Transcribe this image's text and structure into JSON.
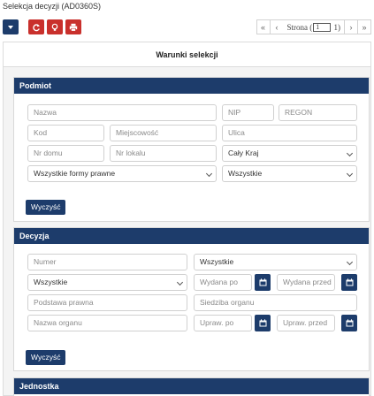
{
  "page": {
    "title": "Selekcja decyzji (AD0360S)"
  },
  "toolbar": {
    "dropdown_icon": "caret-down-icon",
    "refresh_icon": "refresh-icon",
    "lightbulb_icon": "lightbulb-icon",
    "print_icon": "print-icon",
    "accent_blue": "#1d3c6b",
    "accent_red": "#c9302c"
  },
  "pager": {
    "first": "«",
    "prev": "‹",
    "label": "Strona",
    "current_page": "1",
    "total": "1)",
    "next": "›",
    "last": "»"
  },
  "conditions": {
    "title": "Warunki selekcji"
  },
  "podmiot": {
    "title": "Podmiot",
    "nazwa": "Nazwa",
    "nip": "NIP",
    "regon": "REGON",
    "kod": "Kod",
    "miejscowosc": "Miejscowość",
    "ulica": "Ulica",
    "nr_domu": "Nr domu",
    "nr_lokalu": "Nr lokalu",
    "region": "Cały Kraj",
    "forma_prawna": "Wszystkie formy prawne",
    "status": "Wszystkie",
    "clear": "Wyczyść"
  },
  "decyzja": {
    "title": "Decyzja",
    "numer": "Numer",
    "typ": "Wszystkie",
    "rodzaj": "Wszystkie",
    "wydana_po": "Wydana po",
    "wydana_przed": "Wydana przed",
    "podstawa_prawna": "Podstawa prawna",
    "siedziba_organu": "Siedziba organu",
    "nazwa_organu": "Nazwa organu",
    "upraw_po": "Upraw. po",
    "upraw_przed": "Upraw. przed",
    "clear": "Wyczyść"
  },
  "jednostka": {
    "title": "Jednostka"
  }
}
